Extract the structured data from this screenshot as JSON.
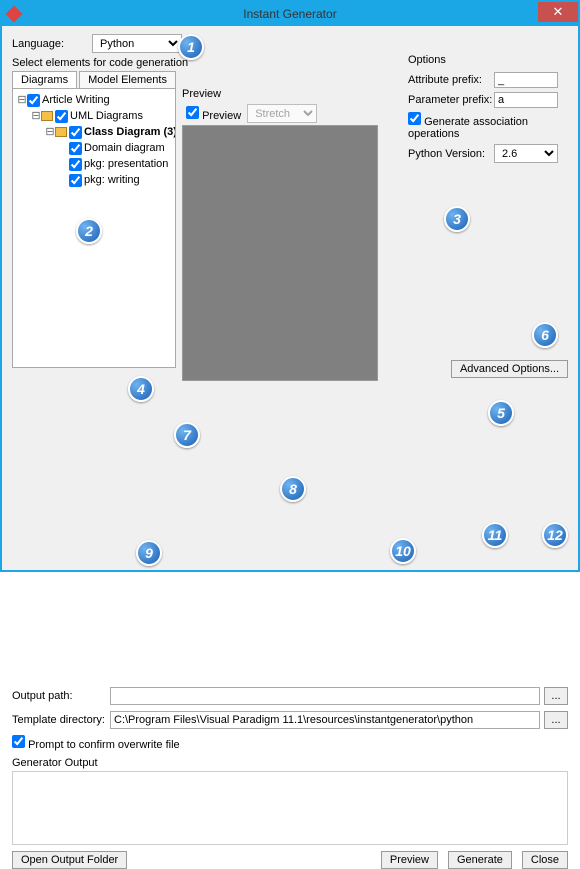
{
  "window": {
    "title": "Instant Generator",
    "close": "✕"
  },
  "language": {
    "label": "Language:",
    "value": "Python"
  },
  "selectElements": {
    "label": "Select elements for code generation"
  },
  "tabs": {
    "diagrams": "Diagrams",
    "modelElements": "Model Elements"
  },
  "tree": {
    "articleWriting": "Article Writing",
    "umlDiagrams": "UML Diagrams",
    "classDiagram": "Class Diagram (3)",
    "domain": "Domain diagram",
    "presentation": "pkg: presentation",
    "writing": "pkg: writing"
  },
  "preview": {
    "group": "Preview",
    "checkbox": "Preview",
    "mode": "Stretch"
  },
  "options": {
    "group": "Options",
    "attrPrefix": {
      "label": "Attribute prefix:",
      "value": "_"
    },
    "paramPrefix": {
      "label": "Parameter prefix:",
      "value": "a"
    },
    "genAssoc": "Generate association operations",
    "pyVersion": {
      "label": "Python Version:",
      "value": "2.6"
    }
  },
  "advanced": "Advanced Options...",
  "outputPath": {
    "label": "Output path:",
    "value": ""
  },
  "templateDir": {
    "label": "Template directory:",
    "value": "C:\\Program Files\\Visual Paradigm 11.1\\resources\\instantgenerator\\python"
  },
  "prompt": "Prompt to confirm overwrite file",
  "genOutput": "Generator Output",
  "buttons": {
    "openFolder": "Open Output Folder",
    "preview": "Preview",
    "generate": "Generate",
    "close": "Close",
    "browse": "..."
  },
  "badges": {
    "b1": "1",
    "b2": "2",
    "b3": "3",
    "b4": "4",
    "b5": "5",
    "b6": "6",
    "b7": "7",
    "b8": "8",
    "b9": "9",
    "b10": "10",
    "b11": "11",
    "b12": "12"
  }
}
